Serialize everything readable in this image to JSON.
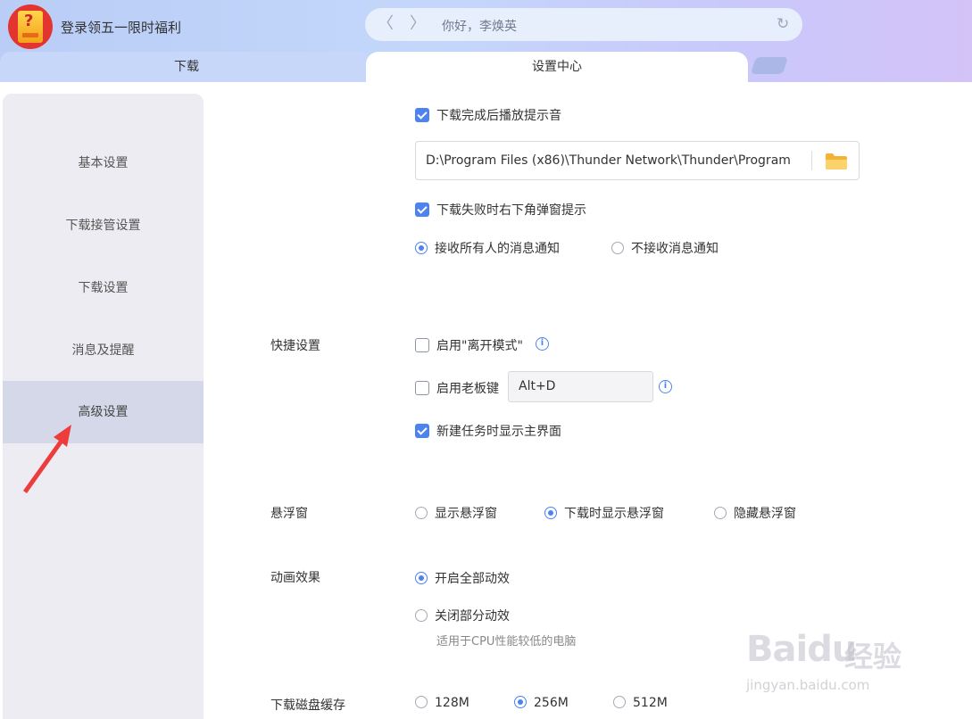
{
  "header": {
    "promo_text": "登录领五一限时福利",
    "address_text": "你好，李焕英",
    "back_glyph": "〈",
    "forward_glyph": "〉",
    "refresh_glyph": "↻"
  },
  "tabs": [
    {
      "label": "下载",
      "active": false
    },
    {
      "label": "设置中心",
      "active": true
    }
  ],
  "sidebar": {
    "items": [
      {
        "label": "基本设置",
        "active": false
      },
      {
        "label": "下载接管设置",
        "active": false
      },
      {
        "label": "下载设置",
        "active": false
      },
      {
        "label": "消息及提醒",
        "active": false
      },
      {
        "label": "高级设置",
        "active": true
      }
    ]
  },
  "notify": {
    "play_sound_label": "下载完成后播放提示音",
    "play_sound_checked": true,
    "sound_path": "D:\\Program Files (x86)\\Thunder Network\\Thunder\\Program",
    "fail_popup_label": "下载失败时右下角弹窗提示",
    "fail_popup_checked": true,
    "receive_all_label": "接收所有人的消息通知",
    "receive_none_label": "不接收消息通知",
    "selected": "receive_all"
  },
  "shortcut": {
    "section_label": "快捷设置",
    "away_mode_label": "启用\"离开模式\"",
    "away_mode_checked": false,
    "boss_key_label": "启用老板键",
    "boss_key_checked": false,
    "boss_key_value": "Alt+D",
    "show_main_label": "新建任务时显示主界面",
    "show_main_checked": true
  },
  "floating": {
    "section_label": "悬浮窗",
    "options": [
      "显示悬浮窗",
      "下载时显示悬浮窗",
      "隐藏悬浮窗"
    ],
    "selected_index": 1
  },
  "animation": {
    "section_label": "动画效果",
    "enable_all_label": "开启全部动效",
    "disable_some_label": "关闭部分动效",
    "disable_some_hint": "适用于CPU性能较低的电脑",
    "selected": "enable_all"
  },
  "disk_cache": {
    "section_label": "下载磁盘缓存",
    "options": [
      "128M",
      "256M",
      "512M"
    ],
    "selected_index": 1
  },
  "watermark": {
    "brand": "Baidu",
    "jingyan": "经验",
    "url": "jingyan.baidu.com"
  },
  "colors": {
    "accent": "#4d83f0",
    "sidebar_bg": "#ececf2",
    "sidebar_active": "#d5d8e8",
    "annotation_arrow": "#ee3b3b"
  }
}
